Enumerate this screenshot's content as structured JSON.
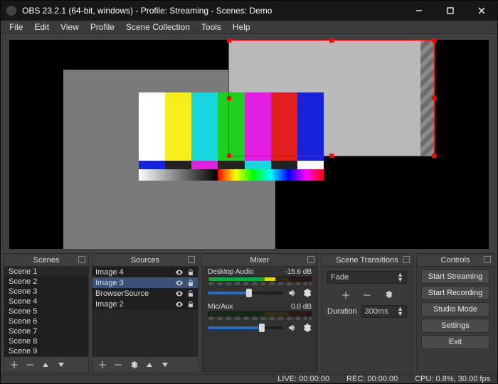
{
  "window": {
    "title": "OBS 23.2.1 (64-bit, windows) - Profile: Streaming - Scenes: Demo"
  },
  "menu": [
    "File",
    "Edit",
    "View",
    "Profile",
    "Scene Collection",
    "Tools",
    "Help"
  ],
  "scenes": {
    "title": "Scenes",
    "items": [
      "Scene 1",
      "Scene 2",
      "Scene 3",
      "Scene 4",
      "Scene 5",
      "Scene 6",
      "Scene 7",
      "Scene 8",
      "Scene 9"
    ],
    "selected_index": 0
  },
  "sources": {
    "title": "Sources",
    "items": [
      {
        "name": "Image 4",
        "visible": true,
        "locked": true,
        "selected": false
      },
      {
        "name": "Image 3",
        "visible": true,
        "locked": true,
        "selected": true
      },
      {
        "name": "BrowserSource",
        "visible": true,
        "locked": false,
        "selected": false
      },
      {
        "name": "Image 2",
        "visible": true,
        "locked": true,
        "selected": false
      }
    ]
  },
  "mixer": {
    "title": "Mixer",
    "ticks": [
      "-60",
      "-55",
      "-50",
      "-45",
      "-40",
      "-35",
      "-30",
      "-25",
      "-20",
      "-15",
      "-10",
      "-5",
      "0"
    ],
    "channels": [
      {
        "name": "Desktop Audio",
        "db": "-15.6 dB",
        "level_pct": 65,
        "vol_pct": 55
      },
      {
        "name": "Mic/Aux",
        "db": "0.0 dB",
        "level_pct": 0,
        "vol_pct": 72
      }
    ]
  },
  "transitions": {
    "title": "Scene Transitions",
    "current": "Fade",
    "duration_label": "Duration",
    "duration_value": "300ms"
  },
  "controls": {
    "title": "Controls",
    "buttons": [
      "Start Streaming",
      "Start Recording",
      "Studio Mode",
      "Settings",
      "Exit"
    ]
  },
  "status": {
    "live": "LIVE: 00:00:00",
    "rec": "REC: 00:00:00",
    "cpu": "CPU: 0.8%, 30.00 fps"
  }
}
